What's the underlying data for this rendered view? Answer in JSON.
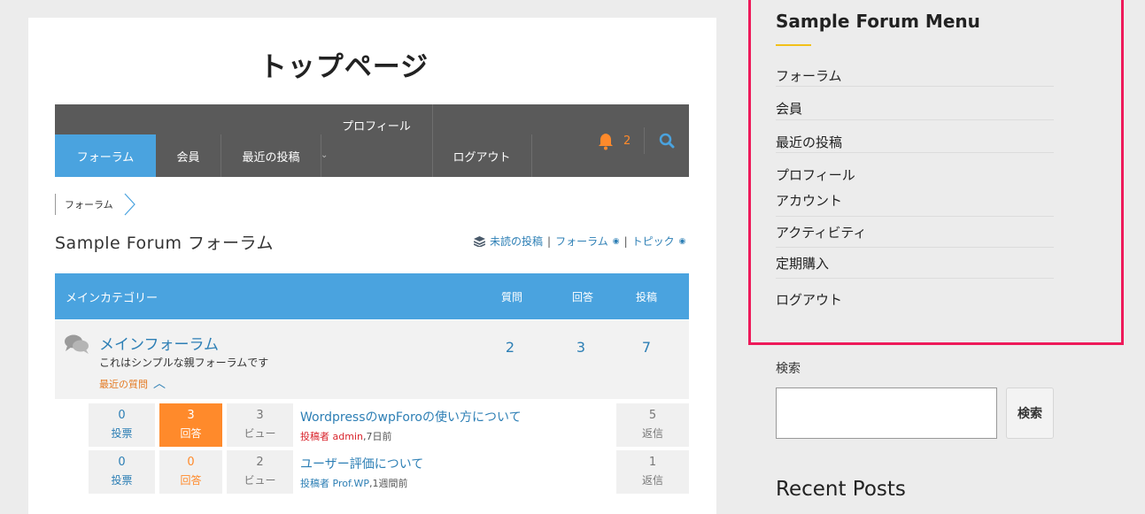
{
  "page": {
    "title": "トップページ"
  },
  "nav": {
    "items": [
      "フォーラム",
      "会員",
      "最近の投稿",
      "プロフィール",
      "ログアウト"
    ],
    "notification_count": "2",
    "accent": "#4aa3df",
    "bar_color": "#5a5a5a"
  },
  "breadcrumb": {
    "current": "フォーラム"
  },
  "forum": {
    "heading": "Sample Forum フォーラム",
    "links": [
      "未読の投稿",
      "フォーラム",
      "トピック"
    ],
    "category": {
      "name": "メインカテゴリー",
      "columns": [
        "質問",
        "回答",
        "投稿"
      ]
    },
    "main_forum": {
      "name": "メインフォーラム",
      "description": "これはシンプルな親フォーラムです",
      "recent_label": "最近の質問",
      "stats": [
        "2",
        "3",
        "7"
      ]
    },
    "topics": [
      {
        "votes": "0",
        "votes_label": "投票",
        "answers": "3",
        "answers_label": "回答",
        "views": "3",
        "views_label": "ビュー",
        "title": "WordpressのwpForoの使い方について",
        "meta_prefix": "投稿者",
        "author": "admin",
        "time": ",7日前",
        "replies": "5",
        "replies_label": "返信"
      },
      {
        "votes": "0",
        "votes_label": "投票",
        "answers": "0",
        "answers_label": "回答",
        "views": "2",
        "views_label": "ビュー",
        "title": "ユーザー評価について",
        "meta_prefix": "投稿者",
        "author": "Prof.WP",
        "time": ",1週間前",
        "replies": "1",
        "replies_label": "返信"
      }
    ]
  },
  "sidebar": {
    "title": "Sample Forum Menu",
    "items": [
      "フォーラム",
      "会員",
      "最近の投稿",
      "プロフィール",
      "アカウント",
      "アクティビティ",
      "定期購入",
      "ログアウト"
    ],
    "highlight_color": "#ee1a5a",
    "search_label": "検索",
    "search_button": "検索",
    "recent_posts": "Recent Posts"
  }
}
